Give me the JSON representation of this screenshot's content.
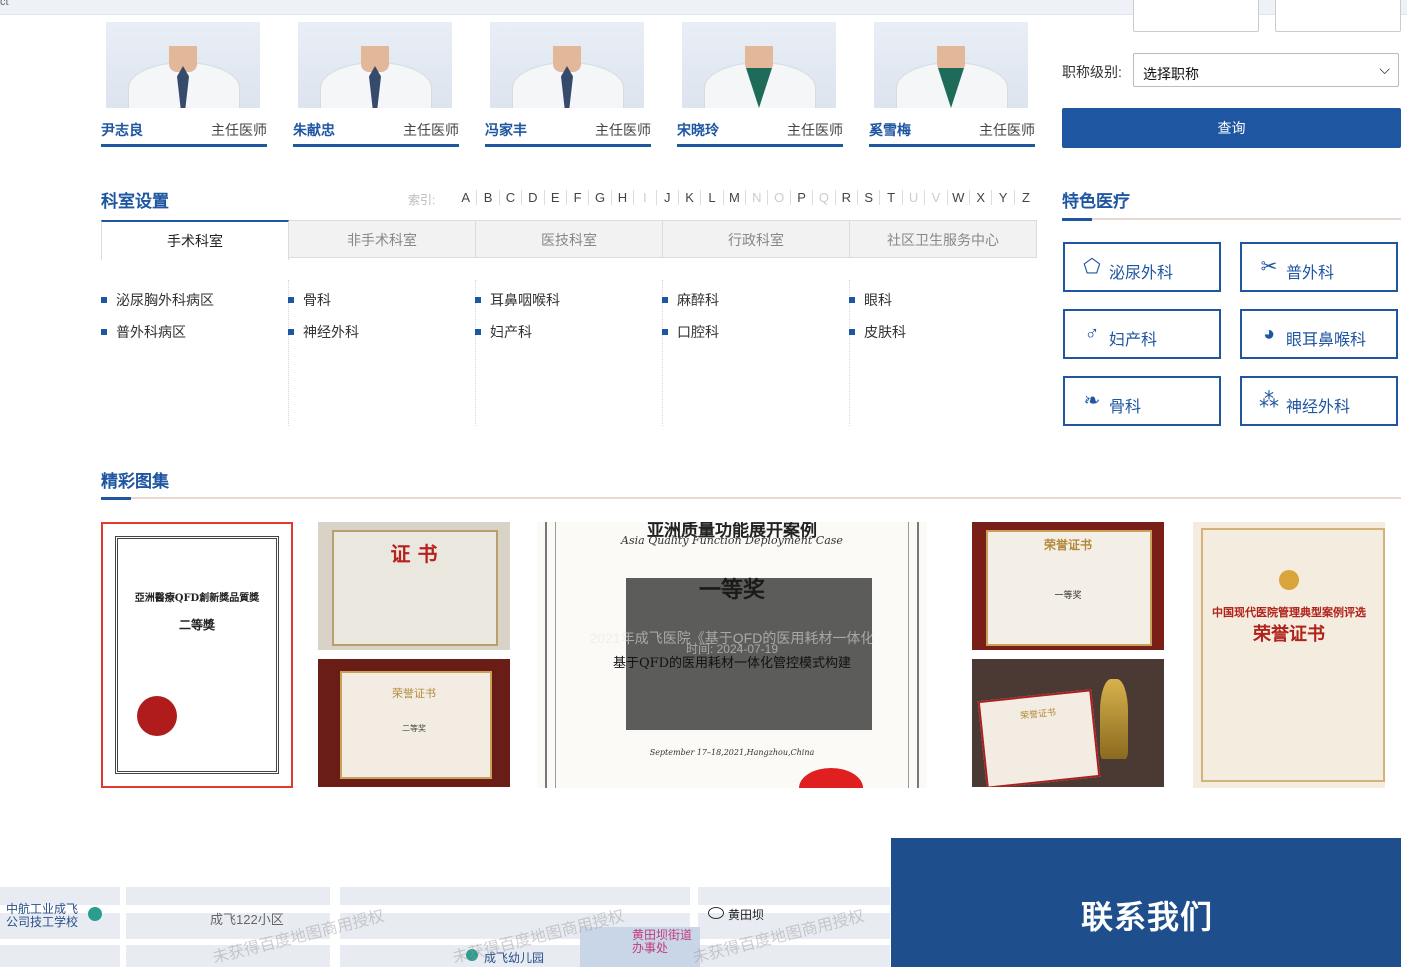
{
  "doctors": [
    {
      "name": "尹志良",
      "title": "主任医师"
    },
    {
      "name": "朱献忠",
      "title": "主任医师"
    },
    {
      "name": "冯家丰",
      "title": "主任医师"
    },
    {
      "name": "宋晓玲",
      "title": "主任医师"
    },
    {
      "name": "奚雪梅",
      "title": "主任医师"
    }
  ],
  "search_form": {
    "level_label": "职称级别:",
    "level_select": "选择职称",
    "query_button": "查询"
  },
  "departments": {
    "title": "科室设置",
    "index_label": "索引:",
    "letters": [
      "A",
      "B",
      "C",
      "D",
      "E",
      "F",
      "G",
      "H",
      "I",
      "J",
      "K",
      "L",
      "M",
      "N",
      "O",
      "P",
      "Q",
      "R",
      "S",
      "T",
      "U",
      "V",
      "W",
      "X",
      "Y",
      "Z"
    ],
    "dim_letters": [
      "I",
      "N",
      "O",
      "Q",
      "U",
      "V"
    ],
    "tabs": [
      "手术科室",
      "非手术科室",
      "医技科室",
      "行政科室",
      "社区卫生服务中心"
    ],
    "columns": [
      [
        "泌尿胸外科病区",
        "普外科病区"
      ],
      [
        "骨科",
        "神经外科"
      ],
      [
        "耳鼻咽喉科",
        "妇产科"
      ],
      [
        "麻醉科",
        "口腔科"
      ],
      [
        "眼科",
        "皮肤科"
      ]
    ]
  },
  "features": {
    "title": "特色医疗",
    "items": [
      {
        "label": "泌尿外科",
        "icon": "kidney-icon"
      },
      {
        "label": "普外科",
        "icon": "scissors-icon"
      },
      {
        "label": "妇产科",
        "icon": "gender-icon"
      },
      {
        "label": "眼耳鼻喉科",
        "icon": "head-icon"
      },
      {
        "label": "骨科",
        "icon": "bone-icon"
      },
      {
        "label": "神经外科",
        "icon": "neuron-icon"
      }
    ]
  },
  "gallery": {
    "title": "精彩图集",
    "cert1": {
      "line1": "亞洲醫療QFD創新獎品質獎",
      "line2": "二等獎"
    },
    "cert2": {
      "line1": "证 书"
    },
    "cert3": {
      "line1": "荣誉证书",
      "line2": "二等奖"
    },
    "cert4": {
      "line1": "亚洲质量功能展开案例",
      "line2": "Asia Quality Function Deployment Case",
      "line3": "一等奖",
      "line4": "基于QFD的医用耗材一体化管控模式构建",
      "line5": "September 17–18,2021,Hangzhou,China",
      "overlay": "2021年成飞医院《基于QFD的医用耗材一体化",
      "time": "时间: 2024-07-19"
    },
    "cert5": {
      "line1": "荣誉证书",
      "line2": "一等奖"
    },
    "cert6": {
      "line1": "荣誉证书"
    },
    "cert7": {
      "line1": "中国现代医院管理典型案例评选",
      "line2": "荣誉证书"
    }
  },
  "map": {
    "labels": [
      "中航工业成飞公司技工学校",
      "成飞122小区",
      "黄田坝",
      "黄田坝街道办事处",
      "成飞幼儿园"
    ],
    "watermark": "未获得百度地图商用授权"
  },
  "contact": {
    "title": "联系我们"
  },
  "colors": {
    "brand": "#1f56a1",
    "contact_bg": "#1f4e8c"
  }
}
